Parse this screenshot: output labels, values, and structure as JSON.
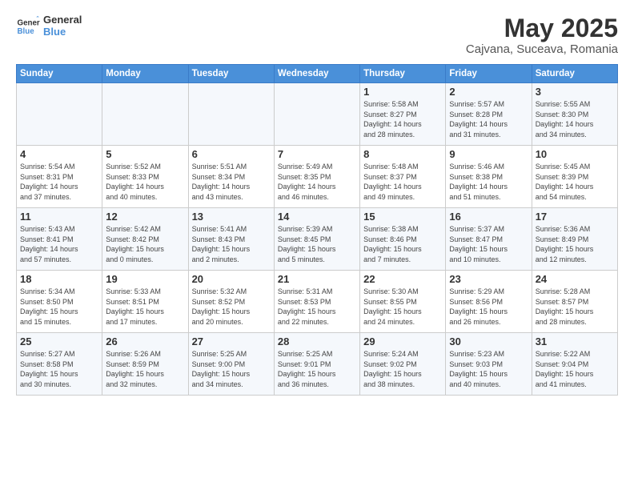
{
  "logo": {
    "line1": "General",
    "line2": "Blue"
  },
  "title": "May 2025",
  "location": "Cajvana, Suceava, Romania",
  "weekdays": [
    "Sunday",
    "Monday",
    "Tuesday",
    "Wednesday",
    "Thursday",
    "Friday",
    "Saturday"
  ],
  "weeks": [
    [
      {
        "day": "",
        "info": ""
      },
      {
        "day": "",
        "info": ""
      },
      {
        "day": "",
        "info": ""
      },
      {
        "day": "",
        "info": ""
      },
      {
        "day": "1",
        "info": "Sunrise: 5:58 AM\nSunset: 8:27 PM\nDaylight: 14 hours\nand 28 minutes."
      },
      {
        "day": "2",
        "info": "Sunrise: 5:57 AM\nSunset: 8:28 PM\nDaylight: 14 hours\nand 31 minutes."
      },
      {
        "day": "3",
        "info": "Sunrise: 5:55 AM\nSunset: 8:30 PM\nDaylight: 14 hours\nand 34 minutes."
      }
    ],
    [
      {
        "day": "4",
        "info": "Sunrise: 5:54 AM\nSunset: 8:31 PM\nDaylight: 14 hours\nand 37 minutes."
      },
      {
        "day": "5",
        "info": "Sunrise: 5:52 AM\nSunset: 8:33 PM\nDaylight: 14 hours\nand 40 minutes."
      },
      {
        "day": "6",
        "info": "Sunrise: 5:51 AM\nSunset: 8:34 PM\nDaylight: 14 hours\nand 43 minutes."
      },
      {
        "day": "7",
        "info": "Sunrise: 5:49 AM\nSunset: 8:35 PM\nDaylight: 14 hours\nand 46 minutes."
      },
      {
        "day": "8",
        "info": "Sunrise: 5:48 AM\nSunset: 8:37 PM\nDaylight: 14 hours\nand 49 minutes."
      },
      {
        "day": "9",
        "info": "Sunrise: 5:46 AM\nSunset: 8:38 PM\nDaylight: 14 hours\nand 51 minutes."
      },
      {
        "day": "10",
        "info": "Sunrise: 5:45 AM\nSunset: 8:39 PM\nDaylight: 14 hours\nand 54 minutes."
      }
    ],
    [
      {
        "day": "11",
        "info": "Sunrise: 5:43 AM\nSunset: 8:41 PM\nDaylight: 14 hours\nand 57 minutes."
      },
      {
        "day": "12",
        "info": "Sunrise: 5:42 AM\nSunset: 8:42 PM\nDaylight: 15 hours\nand 0 minutes."
      },
      {
        "day": "13",
        "info": "Sunrise: 5:41 AM\nSunset: 8:43 PM\nDaylight: 15 hours\nand 2 minutes."
      },
      {
        "day": "14",
        "info": "Sunrise: 5:39 AM\nSunset: 8:45 PM\nDaylight: 15 hours\nand 5 minutes."
      },
      {
        "day": "15",
        "info": "Sunrise: 5:38 AM\nSunset: 8:46 PM\nDaylight: 15 hours\nand 7 minutes."
      },
      {
        "day": "16",
        "info": "Sunrise: 5:37 AM\nSunset: 8:47 PM\nDaylight: 15 hours\nand 10 minutes."
      },
      {
        "day": "17",
        "info": "Sunrise: 5:36 AM\nSunset: 8:49 PM\nDaylight: 15 hours\nand 12 minutes."
      }
    ],
    [
      {
        "day": "18",
        "info": "Sunrise: 5:34 AM\nSunset: 8:50 PM\nDaylight: 15 hours\nand 15 minutes."
      },
      {
        "day": "19",
        "info": "Sunrise: 5:33 AM\nSunset: 8:51 PM\nDaylight: 15 hours\nand 17 minutes."
      },
      {
        "day": "20",
        "info": "Sunrise: 5:32 AM\nSunset: 8:52 PM\nDaylight: 15 hours\nand 20 minutes."
      },
      {
        "day": "21",
        "info": "Sunrise: 5:31 AM\nSunset: 8:53 PM\nDaylight: 15 hours\nand 22 minutes."
      },
      {
        "day": "22",
        "info": "Sunrise: 5:30 AM\nSunset: 8:55 PM\nDaylight: 15 hours\nand 24 minutes."
      },
      {
        "day": "23",
        "info": "Sunrise: 5:29 AM\nSunset: 8:56 PM\nDaylight: 15 hours\nand 26 minutes."
      },
      {
        "day": "24",
        "info": "Sunrise: 5:28 AM\nSunset: 8:57 PM\nDaylight: 15 hours\nand 28 minutes."
      }
    ],
    [
      {
        "day": "25",
        "info": "Sunrise: 5:27 AM\nSunset: 8:58 PM\nDaylight: 15 hours\nand 30 minutes."
      },
      {
        "day": "26",
        "info": "Sunrise: 5:26 AM\nSunset: 8:59 PM\nDaylight: 15 hours\nand 32 minutes."
      },
      {
        "day": "27",
        "info": "Sunrise: 5:25 AM\nSunset: 9:00 PM\nDaylight: 15 hours\nand 34 minutes."
      },
      {
        "day": "28",
        "info": "Sunrise: 5:25 AM\nSunset: 9:01 PM\nDaylight: 15 hours\nand 36 minutes."
      },
      {
        "day": "29",
        "info": "Sunrise: 5:24 AM\nSunset: 9:02 PM\nDaylight: 15 hours\nand 38 minutes."
      },
      {
        "day": "30",
        "info": "Sunrise: 5:23 AM\nSunset: 9:03 PM\nDaylight: 15 hours\nand 40 minutes."
      },
      {
        "day": "31",
        "info": "Sunrise: 5:22 AM\nSunset: 9:04 PM\nDaylight: 15 hours\nand 41 minutes."
      }
    ]
  ]
}
